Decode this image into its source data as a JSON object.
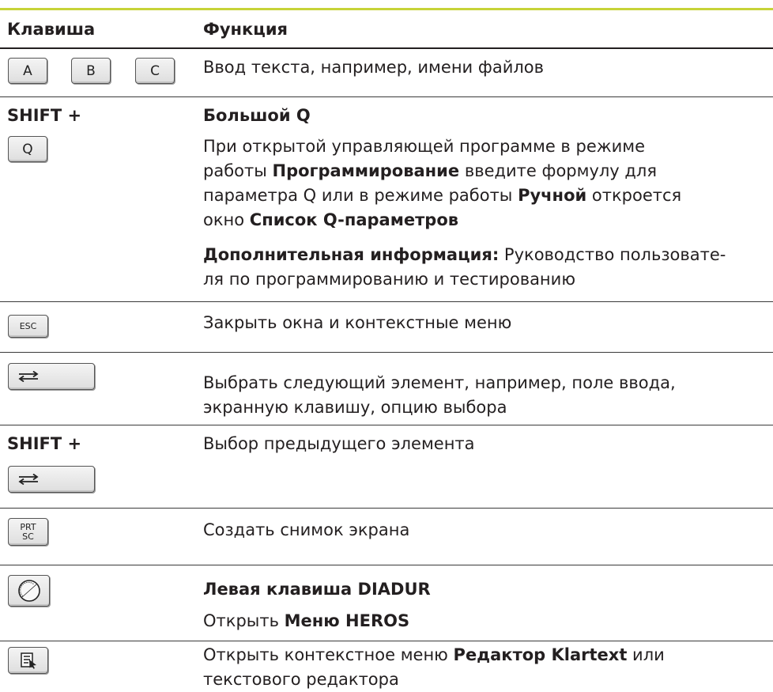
{
  "header": {
    "col1": "Клавиша",
    "col2": "Функция"
  },
  "rows": {
    "r1": {
      "keys": [
        "A",
        "B",
        "C"
      ],
      "text": "Ввод текста, например, имени файлов"
    },
    "r2": {
      "modifier": "SHIFT +",
      "key": "Q",
      "title": "Большой Q",
      "p1": "При открытой управляющей программе в режиме",
      "p2a": "работы ",
      "p2b": "Программирование",
      "p2c": " введите формулу для",
      "p3a": "параметра Q или в режиме работы ",
      "p3b": "Ручной",
      "p3c": " откроется",
      "p4a": "окно ",
      "p4b": "Список Q-параметров",
      "info_label": "Дополнительная информация:",
      "info_text1": " Руководство пользовате-",
      "info_text2": "ля по программированию и тестированию"
    },
    "r3": {
      "key": "ESC",
      "text": "Закрыть окна и контекстные меню"
    },
    "r4": {
      "key_icon": "tab-arrows-icon",
      "line1": "Выбрать следующий элемент, например, поле ввода,",
      "line2": "экранную клавишу, опцию выбора"
    },
    "r5": {
      "modifier": "SHIFT +",
      "key_icon": "tab-arrows-icon",
      "text": "Выбор предыдущего элемента"
    },
    "r6": {
      "key_line1": "PRT",
      "key_line2": "SC",
      "text": "Создать снимок экрана"
    },
    "r7": {
      "key_icon": "diadur-icon",
      "title": "Левая клавиша DIADUR",
      "line_a": "Открыть ",
      "line_b": "Меню HEROS"
    },
    "r8": {
      "key_icon": "context-menu-icon",
      "line1a": "Открыть контекстное меню ",
      "line1b": "Редактор Klartext",
      "line1c": " или",
      "line2": "текстового редактора"
    }
  }
}
